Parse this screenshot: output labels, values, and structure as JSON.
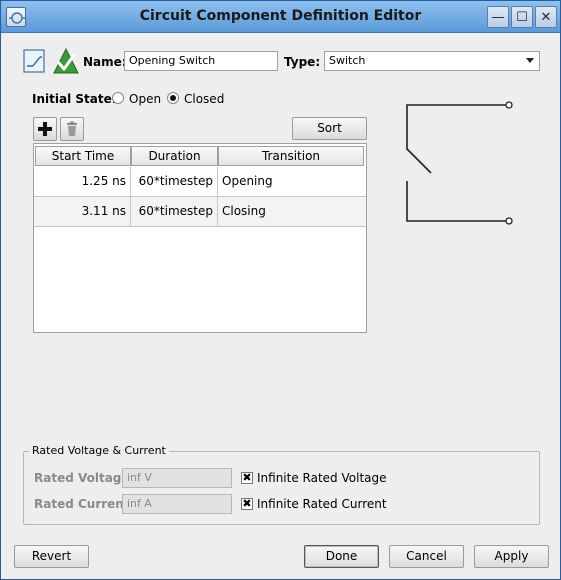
{
  "window": {
    "title": "Circuit Component Definition Editor",
    "minimize_glyph": "—",
    "maximize_glyph": "☐",
    "close_glyph": "✕"
  },
  "form": {
    "name_label": "Name:",
    "name_value": "Opening Switch",
    "type_label": "Type:",
    "type_value": "Switch",
    "initial_state_label": "Initial State:",
    "state_open_label": "Open",
    "state_closed_label": "Closed",
    "initial_state_selected": "Closed"
  },
  "toolbar": {
    "add_icon": "plus-icon",
    "delete_icon": "trash-icon",
    "sort_label": "Sort"
  },
  "table": {
    "columns": [
      "Start Time",
      "Duration",
      "Transition"
    ],
    "rows": [
      {
        "start_time": "1.25 ns",
        "duration": "60*timestep",
        "transition": "Opening"
      },
      {
        "start_time": "3.11 ns",
        "duration": "60*timestep",
        "transition": "Closing"
      }
    ]
  },
  "rated": {
    "group_title": "Rated Voltage & Current",
    "voltage_label": "Rated Voltage:",
    "voltage_value": "inf V",
    "voltage_checkbox_label": "Infinite Rated Voltage",
    "voltage_checked": true,
    "current_label": "Rated Current:",
    "current_value": "inf A",
    "current_checkbox_label": "Infinite Rated Current",
    "current_checked": true
  },
  "buttons": {
    "revert": "Revert",
    "done": "Done",
    "cancel": "Cancel",
    "apply": "Apply"
  },
  "colors": {
    "titlebar": "#5b9ad8",
    "accent_green": "#2e8b2e"
  }
}
